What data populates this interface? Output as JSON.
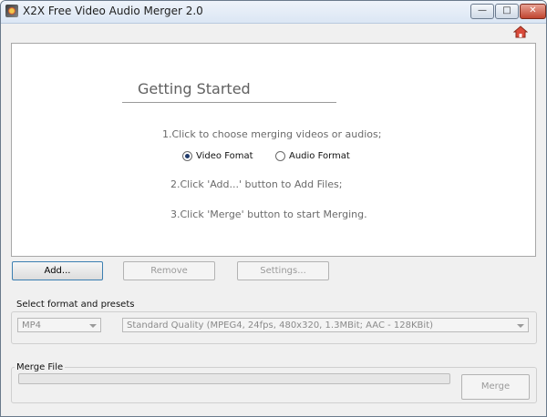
{
  "window": {
    "title": "X2X Free Video Audio Merger 2.0",
    "controls": {
      "minimize": "—",
      "maximize": "□",
      "close": "✕"
    }
  },
  "toolbar": {
    "home_icon": "home-icon"
  },
  "getting_started": {
    "heading": "Getting Started",
    "step1": "1.Click to choose merging videos or audios;",
    "step2": "2.Click 'Add...' button to Add Files;",
    "step3": "3.Click 'Merge' button to start Merging.",
    "options": [
      {
        "label": "Video Fomat",
        "selected": true
      },
      {
        "label": "Audio Format",
        "selected": false
      }
    ]
  },
  "buttons": {
    "add": "Add...",
    "remove": "Remove",
    "settings": "Settings..."
  },
  "format": {
    "group_title": "Select format and presets",
    "format_value": "MP4",
    "preset_value": "Standard Quality  (MPEG4,  24fps,  480x320,  1.3MBit;  AAC - 128KBit)"
  },
  "merge": {
    "group_title": "Merge File",
    "progress": 0,
    "button": "Merge"
  },
  "colors": {
    "window_bg": "#f0f0f0",
    "title_gradient_top": "#eef3fa",
    "close_button": "#c0452f"
  }
}
